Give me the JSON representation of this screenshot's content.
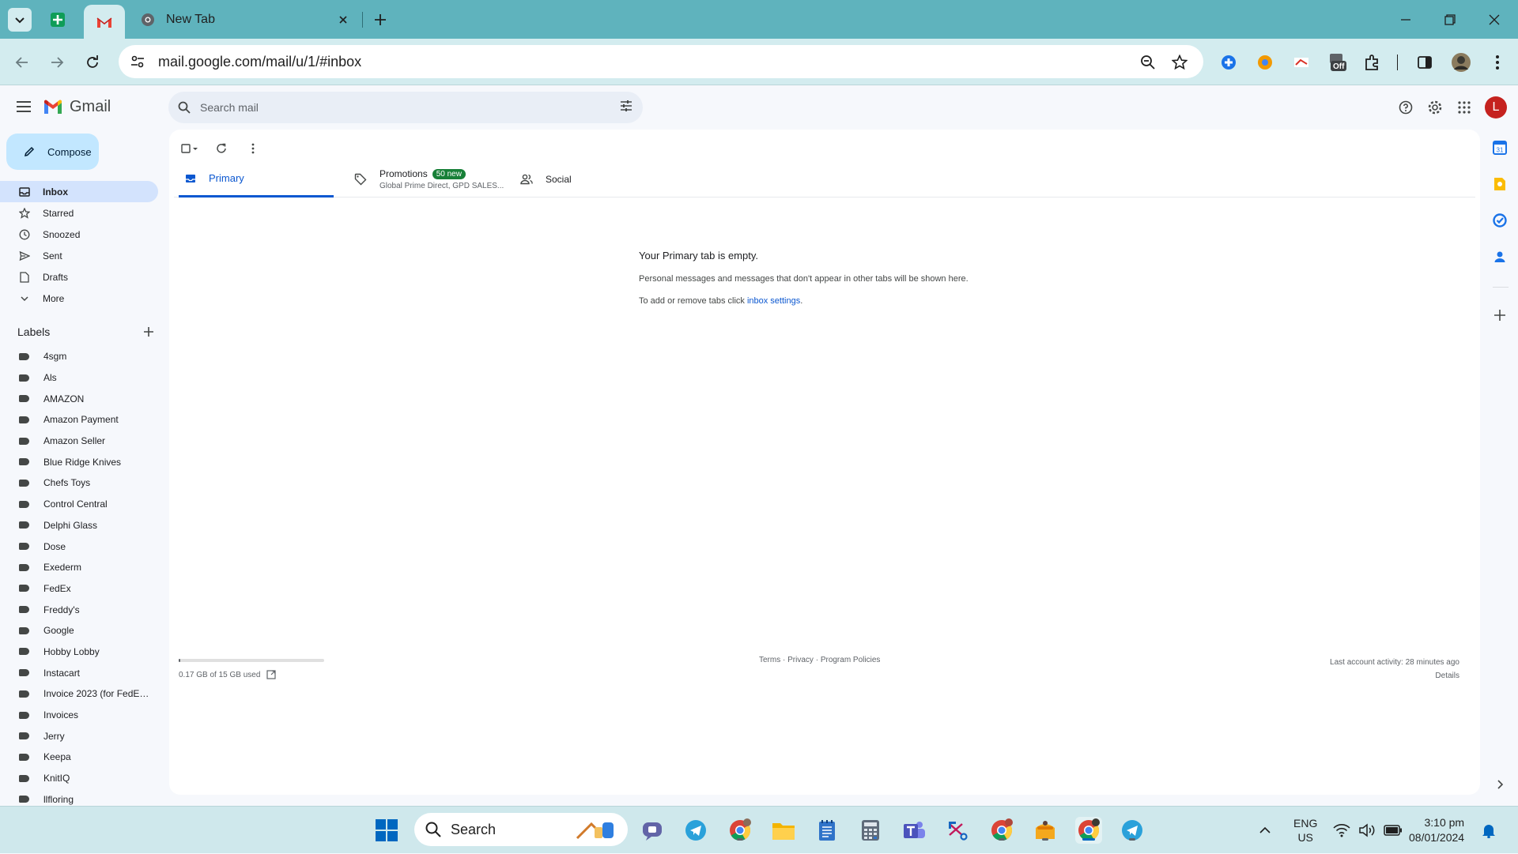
{
  "browser": {
    "tabs": [
      {
        "title": "",
        "favicon": "gmail-icon",
        "active": true
      },
      {
        "title": "New Tab",
        "favicon": "chrome-icon",
        "active": false
      }
    ],
    "url": "mail.google.com/mail/u/1/#inbox",
    "extension_badge": "Off"
  },
  "gmail": {
    "app_name": "Gmail",
    "search_placeholder": "Search mail",
    "account_initial": "L",
    "compose_label": "Compose",
    "nav": [
      {
        "label": "Inbox",
        "icon": "inbox-icon",
        "active": true
      },
      {
        "label": "Starred",
        "icon": "star-icon"
      },
      {
        "label": "Snoozed",
        "icon": "clock-icon"
      },
      {
        "label": "Sent",
        "icon": "send-icon"
      },
      {
        "label": "Drafts",
        "icon": "file-icon"
      },
      {
        "label": "More",
        "icon": "chevron-down-icon"
      }
    ],
    "labels_title": "Labels",
    "labels": [
      "4sgm",
      "Als",
      "AMAZON",
      "Amazon Payment",
      "Amazon Seller",
      "Blue Ridge Knives",
      "Chefs Toys",
      "Control Central",
      "Delphi Glass",
      "Dose",
      "Exederm",
      "FedEx",
      "Freddy's",
      "Google",
      "Hobby Lobby",
      "Instacart",
      "Invoice 2023 (for FedEx ...",
      "Invoices",
      "Jerry",
      "Keepa",
      "KnitIQ",
      "llfloring"
    ],
    "inbox_tabs": {
      "primary": "Primary",
      "promotions": "Promotions",
      "promotions_badge": "50 new",
      "promotions_senders": "Global Prime Direct, GPD SALES...",
      "social": "Social"
    },
    "empty": {
      "title": "Your Primary tab is empty.",
      "body": "Personal messages and messages that don't appear in other tabs will be shown here.",
      "settings_prefix": "To add or remove tabs click ",
      "settings_link": "inbox settings",
      "settings_suffix": "."
    },
    "storage": {
      "text": "0.17 GB of 15 GB used",
      "fraction": 0.011
    },
    "footer": {
      "terms": "Terms",
      "privacy": "Privacy",
      "policies": "Program Policies",
      "sep": " · ",
      "last_activity": "Last account activity: 28 minutes ago",
      "details": "Details"
    }
  },
  "taskbar": {
    "search_label": "Search",
    "lang": "ENG",
    "region": "US",
    "time": "3:10 pm",
    "date": "08/01/2024"
  },
  "colors": {
    "tabstrip": "#5fb3bd",
    "toolbar": "#d3ecef",
    "accent": "#0b57d0",
    "compose": "#c2e7ff",
    "badge": "#188038"
  }
}
